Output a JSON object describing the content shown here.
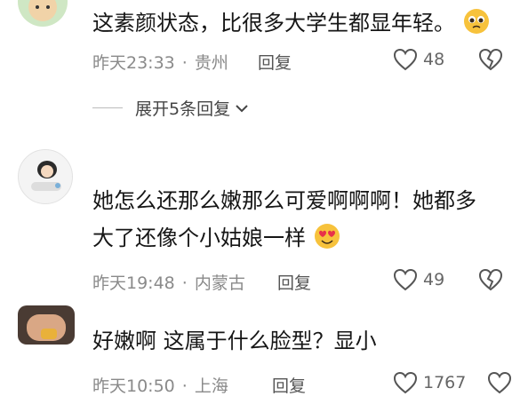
{
  "comments": [
    {
      "text": "这素颜状态，比很多大学生都显年轻。",
      "time": "昨天23:33",
      "location": "贵州",
      "reply_label": "回复",
      "likes": "48",
      "expand_label": "展开5条回复"
    },
    {
      "text_line1": "她怎么还那么嫩那么可爱啊啊啊！她都多",
      "text_line2": "大了还像个小姑娘一样",
      "time": "昨天19:48",
      "location": "内蒙古",
      "reply_label": "回复",
      "likes": "49"
    },
    {
      "text": "好嫩啊 这属于什么脸型？显小",
      "time": "昨天10:50",
      "location": "上海",
      "reply_label": "回复",
      "likes": "1767"
    }
  ],
  "colors": {
    "meta": "#8a8a8a",
    "text": "#161616",
    "accent_emoji": "#f7c23c"
  }
}
